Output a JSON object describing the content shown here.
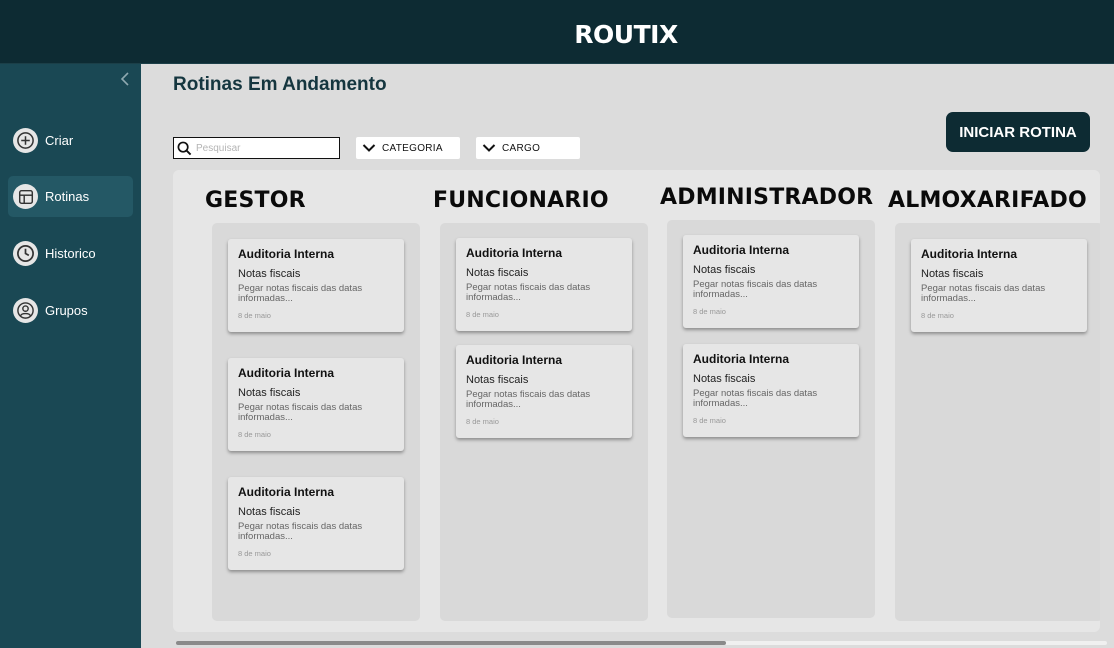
{
  "app": {
    "title": "ROUTIX"
  },
  "sidebar": {
    "collapse_icon": "chevron-left-icon",
    "items": [
      {
        "label": "Criar",
        "icon": "plus-circle-icon",
        "active": false
      },
      {
        "label": "Rotinas",
        "icon": "table-icon",
        "active": true
      },
      {
        "label": "Historico",
        "icon": "clock-icon",
        "active": false
      },
      {
        "label": "Grupos",
        "icon": "user-circle-icon",
        "active": false
      }
    ]
  },
  "main": {
    "title": "Rotinas Em Andamento",
    "search": {
      "placeholder": "Pesquisar",
      "value": ""
    },
    "filters": [
      {
        "label": "CATEGORIA",
        "icon": "chevron-down-icon"
      },
      {
        "label": "CARGO",
        "icon": "chevron-down-icon"
      }
    ],
    "start_button": "INICIAR ROTINA"
  },
  "board": {
    "columns": [
      {
        "title": "GESTOR",
        "cards": [
          {
            "title": "Auditoria Interna",
            "subtitle": "Notas fiscais",
            "description": "Pegar notas fiscais das datas informadas...",
            "date": "8 de maio"
          },
          {
            "title": "Auditoria Interna",
            "subtitle": "Notas fiscais",
            "description": "Pegar notas fiscais das datas informadas...",
            "date": "8 de maio"
          },
          {
            "title": "Auditoria Interna",
            "subtitle": "Notas fiscais",
            "description": "Pegar notas fiscais das datas informadas...",
            "date": "8 de maio"
          }
        ]
      },
      {
        "title": "FUNCIONARIO",
        "cards": [
          {
            "title": "Auditoria Interna",
            "subtitle": "Notas fiscais",
            "description": "Pegar notas fiscais das datas informadas...",
            "date": "8 de maio"
          },
          {
            "title": "Auditoria Interna",
            "subtitle": "Notas fiscais",
            "description": "Pegar notas fiscais das datas informadas...",
            "date": "8 de maio"
          }
        ]
      },
      {
        "title": "ADMINISTRADOR",
        "cards": [
          {
            "title": "Auditoria Interna",
            "subtitle": "Notas fiscais",
            "description": "Pegar notas fiscais das datas informadas...",
            "date": "8 de maio"
          },
          {
            "title": "Auditoria Interna",
            "subtitle": "Notas fiscais",
            "description": "Pegar notas fiscais das datas informadas...",
            "date": "8 de maio"
          }
        ]
      },
      {
        "title": "ALMOXARIFADO",
        "cards": [
          {
            "title": "Auditoria Interna",
            "subtitle": "Notas fiscais",
            "description": "Pegar notas fiscais das datas informadas...",
            "date": "8 de maio"
          }
        ]
      }
    ]
  },
  "colors": {
    "header": "#0d2b33",
    "sidebar": "#1a4854",
    "sidebar_active": "#245865",
    "button": "#0d2b33",
    "background": "#dcdcdc"
  },
  "scrollbar": {
    "horizontal_position": 0.0
  }
}
